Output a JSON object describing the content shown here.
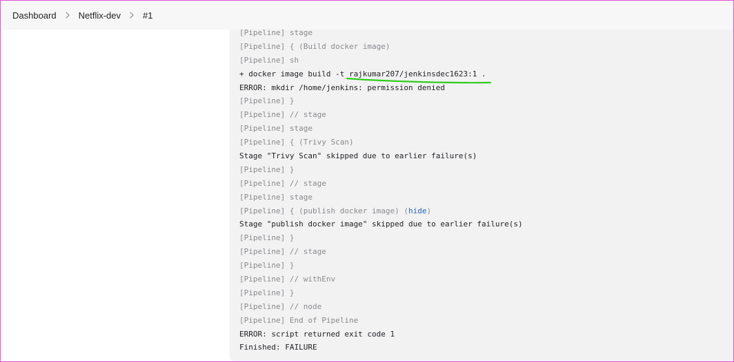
{
  "breadcrumb": {
    "items": [
      {
        "label": "Dashboard"
      },
      {
        "label": "Netflix-dev"
      },
      {
        "label": "#1"
      }
    ]
  },
  "console": {
    "lines": [
      {
        "text": "[Pipeline] stage",
        "style": "dim"
      },
      {
        "text": "[Pipeline] { (Build docker image)",
        "style": "dim"
      },
      {
        "text": "[Pipeline] sh",
        "style": "dim"
      },
      {
        "text": "+ docker image build -t rajkumar207/jenkinsdec1623:1 .",
        "style": "normal"
      },
      {
        "text": "ERROR: mkdir /home/jenkins: permission denied",
        "style": "normal"
      },
      {
        "text": "[Pipeline] }",
        "style": "dim"
      },
      {
        "text": "[Pipeline] // stage",
        "style": "dim"
      },
      {
        "text": "[Pipeline] stage",
        "style": "dim"
      },
      {
        "text": "[Pipeline] { (Trivy Scan)",
        "style": "dim"
      },
      {
        "text": "Stage \"Trivy Scan\" skipped due to earlier failure(s)",
        "style": "normal"
      },
      {
        "text": "[Pipeline] }",
        "style": "dim"
      },
      {
        "text": "[Pipeline] // stage",
        "style": "dim"
      },
      {
        "text": "[Pipeline] stage",
        "style": "dim"
      },
      {
        "text": "[Pipeline] { (publish docker image) (",
        "style": "dim",
        "link": "hide",
        "after": ")"
      },
      {
        "text": "Stage \"publish docker image\" skipped due to earlier failure(s)",
        "style": "normal"
      },
      {
        "text": "[Pipeline] }",
        "style": "dim"
      },
      {
        "text": "[Pipeline] // stage",
        "style": "dim"
      },
      {
        "text": "[Pipeline] }",
        "style": "dim"
      },
      {
        "text": "[Pipeline] // withEnv",
        "style": "dim"
      },
      {
        "text": "[Pipeline] }",
        "style": "dim"
      },
      {
        "text": "[Pipeline] // node",
        "style": "dim"
      },
      {
        "text": "[Pipeline] End of Pipeline",
        "style": "dim"
      },
      {
        "text": "ERROR: script returned exit code 1",
        "style": "normal"
      },
      {
        "text": "Finished: FAILURE",
        "style": "normal"
      }
    ]
  },
  "colors": {
    "annotation": "#2ecc1a",
    "link": "#1f64c8",
    "frame_border": "#e14fd8"
  },
  "icons": {
    "separator": "chevron-right-icon"
  }
}
